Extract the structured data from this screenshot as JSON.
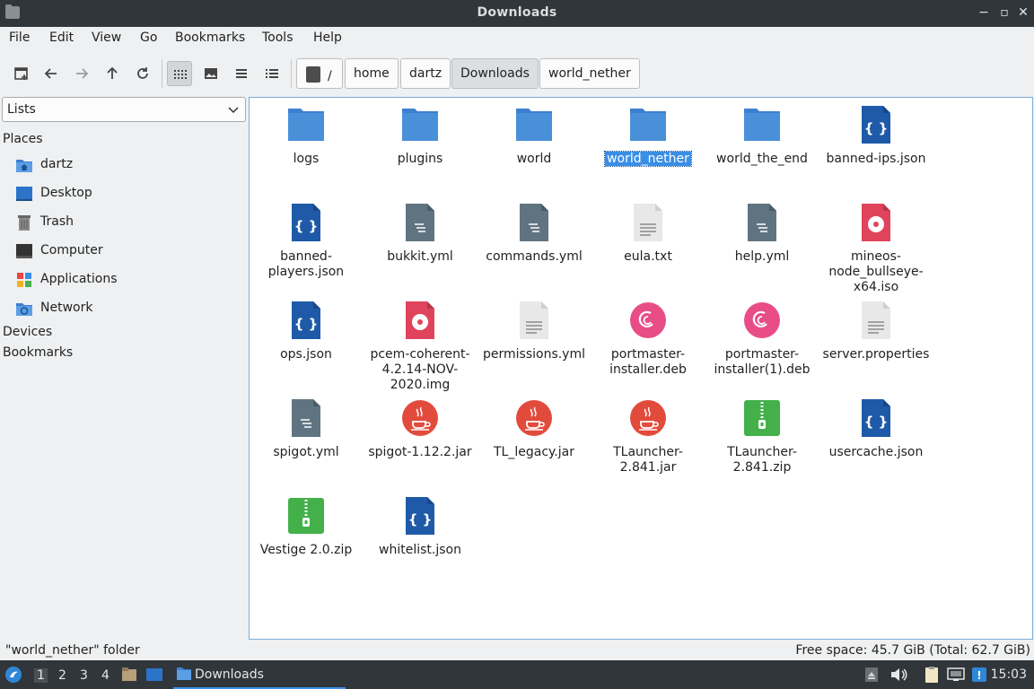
{
  "window": {
    "title": "Downloads"
  },
  "menu": [
    "File",
    "Edit",
    "View",
    "Go",
    "Bookmarks",
    "Tools",
    "Help"
  ],
  "toolbar": {
    "buttons": [
      "new-tab-icon",
      "back-icon",
      "forward-icon",
      "up-icon",
      "reload-icon",
      "icon-view-icon",
      "thumbnail-view-icon",
      "compact-view-icon",
      "detailed-list-icon"
    ],
    "active_view": "icon-view"
  },
  "path": {
    "root": "/",
    "crumbs": [
      "home",
      "dartz",
      "Downloads",
      "world_nether"
    ],
    "current": "Downloads"
  },
  "sidepane": {
    "mode": "Lists",
    "places_header": "Places",
    "places": [
      {
        "label": "dartz",
        "icon": "home-folder-icon"
      },
      {
        "label": "Desktop",
        "icon": "desktop-icon"
      },
      {
        "label": "Trash",
        "icon": "trash-icon"
      },
      {
        "label": "Computer",
        "icon": "computer-icon"
      },
      {
        "label": "Applications",
        "icon": "applications-icon"
      },
      {
        "label": "Network",
        "icon": "network-folder-icon"
      }
    ],
    "devices_header": "Devices",
    "bookmarks_header": "Bookmarks"
  },
  "files": [
    {
      "name": "logs",
      "type": "folder"
    },
    {
      "name": "plugins",
      "type": "folder"
    },
    {
      "name": "world",
      "type": "folder"
    },
    {
      "name": "world_nether",
      "type": "folder",
      "selected": true
    },
    {
      "name": "world_the_end",
      "type": "folder"
    },
    {
      "name": "banned-ips.json",
      "type": "json"
    },
    {
      "name": "banned-players.json",
      "type": "json"
    },
    {
      "name": "bukkit.yml",
      "type": "yml"
    },
    {
      "name": "commands.yml",
      "type": "yml"
    },
    {
      "name": "eula.txt",
      "type": "text"
    },
    {
      "name": "help.yml",
      "type": "yml"
    },
    {
      "name": "mineos-node_bullseye-x64.iso",
      "type": "disc"
    },
    {
      "name": "ops.json",
      "type": "json"
    },
    {
      "name": "pcem-coherent-4.2.14-NOV-2020.img",
      "type": "disc"
    },
    {
      "name": "permissions.yml",
      "type": "text"
    },
    {
      "name": "portmaster-installer.deb",
      "type": "deb"
    },
    {
      "name": "portmaster-installer(1).deb",
      "type": "deb"
    },
    {
      "name": "server.properties",
      "type": "text"
    },
    {
      "name": "spigot.yml",
      "type": "yml"
    },
    {
      "name": "spigot-1.12.2.jar",
      "type": "jar"
    },
    {
      "name": "TL_legacy.jar",
      "type": "jar"
    },
    {
      "name": "TLauncher-2.841.jar",
      "type": "jar"
    },
    {
      "name": "TLauncher-2.841.zip",
      "type": "zip"
    },
    {
      "name": "usercache.json",
      "type": "json"
    },
    {
      "name": "Vestige 2.0.zip",
      "type": "zip"
    },
    {
      "name": "whitelist.json",
      "type": "json"
    }
  ],
  "status": {
    "left": "\"world_nether\" folder",
    "right": "Free space: 45.7 GiB (Total: 62.7 GiB)"
  },
  "taskbar": {
    "workspaces": [
      "1",
      "2",
      "3",
      "4"
    ],
    "active_workspace": "1",
    "task_label": "Downloads",
    "clock": "15:03"
  },
  "colors": {
    "accent": "#3a8ee6",
    "folder": "#4a90d9",
    "json": "#1e5aa8",
    "yml": "#5f7480",
    "jar": "#e24b3b",
    "zip": "#43b04a",
    "deb": "#e84d86",
    "titlebar": "#31363b"
  }
}
